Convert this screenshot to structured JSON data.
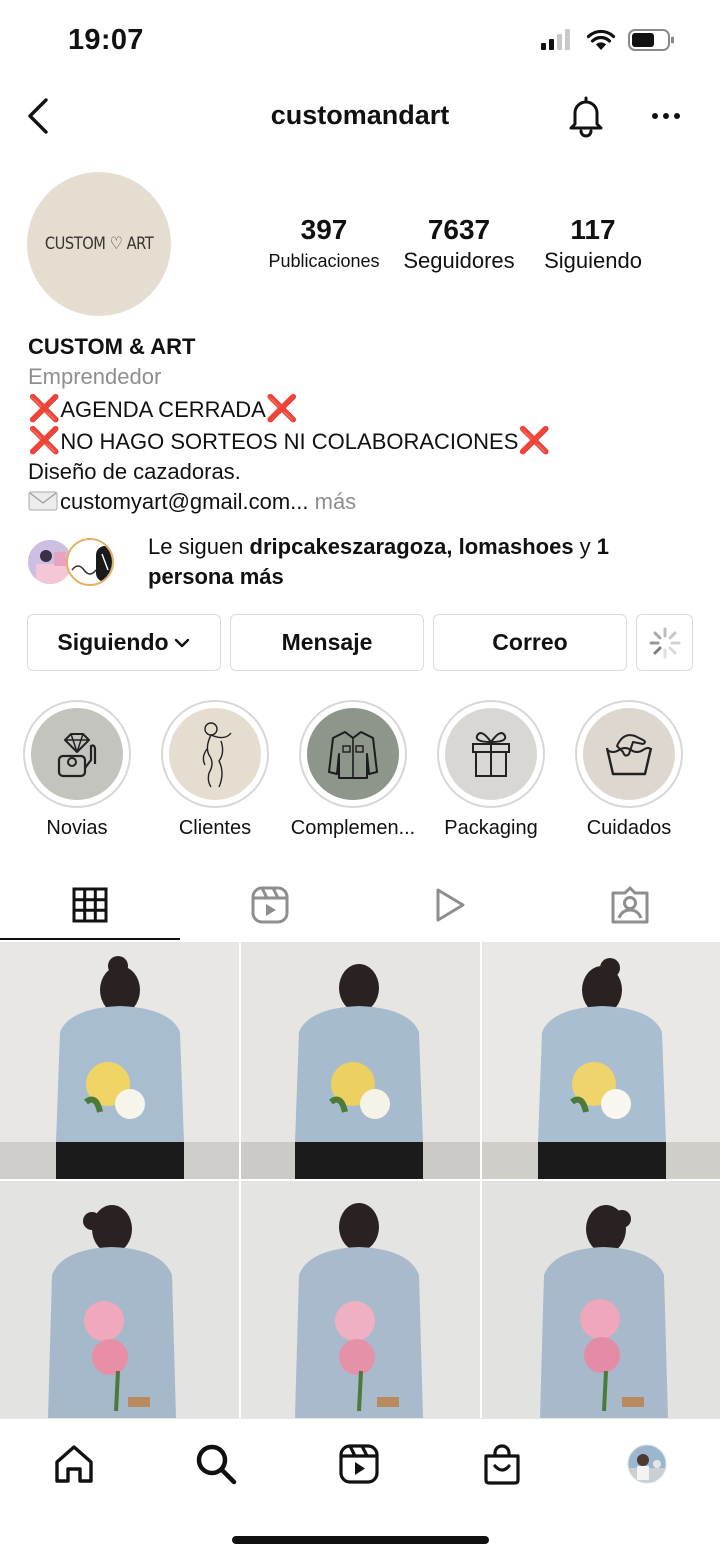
{
  "status_bar": {
    "time": "19:07"
  },
  "header": {
    "username": "customandart"
  },
  "profile": {
    "avatar_text": "CUSTOM ♡ ART",
    "stats": [
      {
        "value": "397",
        "label": "Publicaciones"
      },
      {
        "value": "7637",
        "label": "Seguidores"
      },
      {
        "value": "117",
        "label": "Siguiendo"
      }
    ],
    "name": "CUSTOM & ART",
    "category": "Emprendedor",
    "bio_lines": [
      {
        "prefix": "❌",
        "text": "AGENDA CERRADA",
        "suffix": "❌"
      },
      {
        "prefix": "❌",
        "text": "NO HAGO SORTEOS NI COLABORACIONES",
        "suffix": "❌"
      },
      {
        "prefix": "",
        "text": "Diseño de cazadoras.",
        "suffix": ""
      }
    ],
    "email_line": "customyart@gmail.com...",
    "more_label": "más"
  },
  "followed_by": {
    "prefix": "Le siguen ",
    "names": "dripcakeszaragoza, lomashoes",
    "connector": " y ",
    "rest": "1 persona más"
  },
  "actions": {
    "following_label": "Siguiendo",
    "message_label": "Mensaje",
    "email_label": "Correo"
  },
  "highlights": [
    {
      "label": "Novias",
      "icon": "ring-box-icon",
      "bg": "#c4c4be"
    },
    {
      "label": "Clientes",
      "icon": "woman-line-art-icon",
      "bg": "#e6ddd1"
    },
    {
      "label": "Complemen...",
      "icon": "jacket-icon",
      "bg": "#8e958b"
    },
    {
      "label": "Packaging",
      "icon": "gift-box-icon",
      "bg": "#d9d7d3"
    },
    {
      "label": "Cuidados",
      "icon": "hand-wash-icon",
      "bg": "#ddd7cf"
    }
  ],
  "tabs": [
    {
      "name": "grid-icon",
      "active": true
    },
    {
      "name": "reels-icon",
      "active": false
    },
    {
      "name": "video-play-icon",
      "active": false
    },
    {
      "name": "tagged-icon",
      "active": false
    }
  ],
  "posts": [
    {
      "flower": "#f0d466",
      "accent": "#f7f4ea"
    },
    {
      "flower": "#ecd060",
      "accent": "#f5f2e8"
    },
    {
      "flower": "#efd46b",
      "accent": "#f8f6ee"
    },
    {
      "flower": "#f0a9bc",
      "accent": "#e98ea7"
    },
    {
      "flower": "#efb0c2",
      "accent": "#e592a9"
    },
    {
      "flower": "#eea7bb",
      "accent": "#e48ca5"
    }
  ],
  "bottom_nav": [
    "home-icon",
    "search-icon",
    "reels-icon",
    "shop-icon",
    "profile-avatar"
  ],
  "colors": {
    "xmark": "#e0242b",
    "muted": "#8e8e8e",
    "border": "#dbdbdb"
  }
}
